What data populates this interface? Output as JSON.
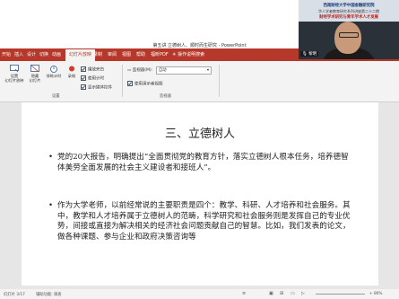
{
  "window": {
    "title": "第五讲 立德树人、顺时而生研究 - PowerPoint"
  },
  "tabs": [
    {
      "label": "开始"
    },
    {
      "label": "插入"
    },
    {
      "label": "设计"
    },
    {
      "label": "切换"
    },
    {
      "label": "动画"
    },
    {
      "label": "幻灯片放映"
    },
    {
      "label": "录制"
    },
    {
      "label": "审阅"
    },
    {
      "label": "视图"
    },
    {
      "label": "帮助"
    },
    {
      "label": "福昕PDF"
    },
    {
      "label": "操作说明搜索"
    }
  ],
  "ribbon": {
    "btn_setup": "设置\n幻灯片放映",
    "btn_hide": "隐藏\n幻灯片",
    "btn_rehearse": "排练计时",
    "btn_record": "录制",
    "check_narration": "播放旁白",
    "check_timings": "使用计时",
    "check_media": "显示媒体控件",
    "group_setup": "设置",
    "monitor_label": "监视器(M):",
    "monitor_value": "自动",
    "check_presenter": "使用演示者视图",
    "group_monitors": "监视器"
  },
  "slide": {
    "title": "三、立德树人",
    "para1": "党的20大报告，明确提出“全面贯彻党的教育方针，落实立德树人根本任务，培养德智体美劳全面发展的社会主义建设者和接班人”。",
    "para2": "作为大学老师，以前经常说的主要职责是四个：教学、科研、人才培养和社会服务。其中，教学和人才培养属于立德树人的范畴，科学研究和社会服务则是发挥自己的专业优势，间接或直接为解决相关的经济社会问题贡献自己的智慧。比如，我们发表的论文，做各种课题、参与企业和政府决策咨询等"
  },
  "status": {
    "slide_info": "幻灯片 3/17",
    "accessibility": "辅助功能: 调查",
    "zoom": "+ 86%"
  },
  "video": {
    "line1": "西南财经大学中国金融研究院",
    "line2": "华人学者教育研究系列讲座第二十二期",
    "line3": "财经学术研究与青年学术人才发展",
    "speaker": "黎明"
  }
}
